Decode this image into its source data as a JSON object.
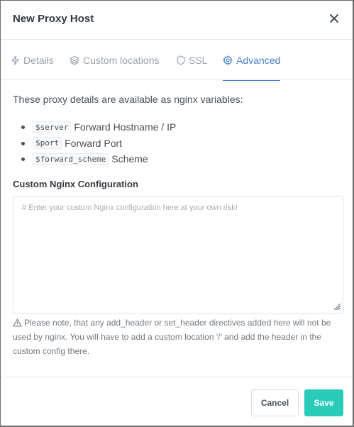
{
  "modal": {
    "title": "New Proxy Host",
    "close_icon": "close-icon"
  },
  "tabs": [
    {
      "label": "Details",
      "icon": "bolt-icon",
      "active": false
    },
    {
      "label": "Custom locations",
      "icon": "layers-icon",
      "active": false
    },
    {
      "label": "SSL",
      "icon": "shield-icon",
      "active": false
    },
    {
      "label": "Advanced",
      "icon": "gear-icon",
      "active": true
    }
  ],
  "advanced": {
    "intro": "These proxy details are available as nginx variables:",
    "variables": [
      {
        "code": "$server",
        "desc": "Forward Hostname / IP"
      },
      {
        "code": "$port",
        "desc": "Forward Port"
      },
      {
        "code": "$forward_scheme",
        "desc": "Scheme"
      }
    ],
    "config_label": "Custom Nginx Configuration",
    "config_placeholder": "# Enter your custom Nginx configuration here at your own risk!",
    "config_value": "",
    "note": "Please note, that any add_header or set_header directives added here will not be used by nginx. You will have to add a custom location '/' and add the header in the custom config there.",
    "note_icon": "warning-icon"
  },
  "footer": {
    "cancel_label": "Cancel",
    "save_label": "Save"
  },
  "colors": {
    "accent": "#467fcf",
    "save": "#2bcbba",
    "muted": "#9aa0ac"
  }
}
